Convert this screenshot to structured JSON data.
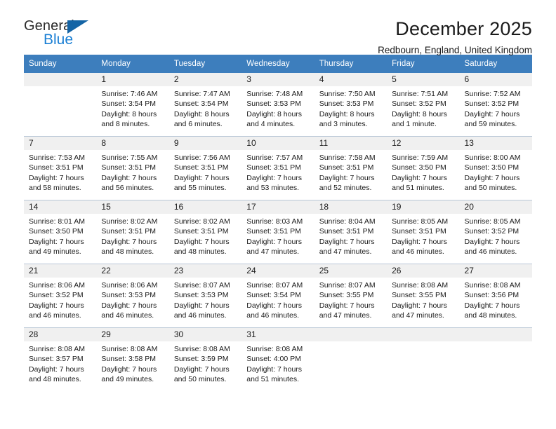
{
  "logo": {
    "text_primary": "General",
    "text_secondary": "Blue",
    "triangle_color": "#1464a5",
    "secondary_color": "#1a7fd4"
  },
  "header": {
    "title": "December 2025",
    "subtitle": "Redbourn, England, United Kingdom"
  },
  "theme": {
    "header_bar_color": "#3d7ebd",
    "daynum_bg": "#f0f0f0",
    "grid_line": "#b9c7d6"
  },
  "calendar": {
    "weekday_headers": [
      "Sunday",
      "Monday",
      "Tuesday",
      "Wednesday",
      "Thursday",
      "Friday",
      "Saturday"
    ],
    "weeks": [
      [
        {
          "day": "",
          "empty": true,
          "sunrise": "",
          "sunset": "",
          "daylight_1": "",
          "daylight_2": ""
        },
        {
          "day": "1",
          "sunrise": "Sunrise: 7:46 AM",
          "sunset": "Sunset: 3:54 PM",
          "daylight_1": "Daylight: 8 hours",
          "daylight_2": "and 8 minutes."
        },
        {
          "day": "2",
          "sunrise": "Sunrise: 7:47 AM",
          "sunset": "Sunset: 3:54 PM",
          "daylight_1": "Daylight: 8 hours",
          "daylight_2": "and 6 minutes."
        },
        {
          "day": "3",
          "sunrise": "Sunrise: 7:48 AM",
          "sunset": "Sunset: 3:53 PM",
          "daylight_1": "Daylight: 8 hours",
          "daylight_2": "and 4 minutes."
        },
        {
          "day": "4",
          "sunrise": "Sunrise: 7:50 AM",
          "sunset": "Sunset: 3:53 PM",
          "daylight_1": "Daylight: 8 hours",
          "daylight_2": "and 3 minutes."
        },
        {
          "day": "5",
          "sunrise": "Sunrise: 7:51 AM",
          "sunset": "Sunset: 3:52 PM",
          "daylight_1": "Daylight: 8 hours",
          "daylight_2": "and 1 minute."
        },
        {
          "day": "6",
          "sunrise": "Sunrise: 7:52 AM",
          "sunset": "Sunset: 3:52 PM",
          "daylight_1": "Daylight: 7 hours",
          "daylight_2": "and 59 minutes."
        }
      ],
      [
        {
          "day": "7",
          "sunrise": "Sunrise: 7:53 AM",
          "sunset": "Sunset: 3:51 PM",
          "daylight_1": "Daylight: 7 hours",
          "daylight_2": "and 58 minutes."
        },
        {
          "day": "8",
          "sunrise": "Sunrise: 7:55 AM",
          "sunset": "Sunset: 3:51 PM",
          "daylight_1": "Daylight: 7 hours",
          "daylight_2": "and 56 minutes."
        },
        {
          "day": "9",
          "sunrise": "Sunrise: 7:56 AM",
          "sunset": "Sunset: 3:51 PM",
          "daylight_1": "Daylight: 7 hours",
          "daylight_2": "and 55 minutes."
        },
        {
          "day": "10",
          "sunrise": "Sunrise: 7:57 AM",
          "sunset": "Sunset: 3:51 PM",
          "daylight_1": "Daylight: 7 hours",
          "daylight_2": "and 53 minutes."
        },
        {
          "day": "11",
          "sunrise": "Sunrise: 7:58 AM",
          "sunset": "Sunset: 3:51 PM",
          "daylight_1": "Daylight: 7 hours",
          "daylight_2": "and 52 minutes."
        },
        {
          "day": "12",
          "sunrise": "Sunrise: 7:59 AM",
          "sunset": "Sunset: 3:50 PM",
          "daylight_1": "Daylight: 7 hours",
          "daylight_2": "and 51 minutes."
        },
        {
          "day": "13",
          "sunrise": "Sunrise: 8:00 AM",
          "sunset": "Sunset: 3:50 PM",
          "daylight_1": "Daylight: 7 hours",
          "daylight_2": "and 50 minutes."
        }
      ],
      [
        {
          "day": "14",
          "sunrise": "Sunrise: 8:01 AM",
          "sunset": "Sunset: 3:50 PM",
          "daylight_1": "Daylight: 7 hours",
          "daylight_2": "and 49 minutes."
        },
        {
          "day": "15",
          "sunrise": "Sunrise: 8:02 AM",
          "sunset": "Sunset: 3:51 PM",
          "daylight_1": "Daylight: 7 hours",
          "daylight_2": "and 48 minutes."
        },
        {
          "day": "16",
          "sunrise": "Sunrise: 8:02 AM",
          "sunset": "Sunset: 3:51 PM",
          "daylight_1": "Daylight: 7 hours",
          "daylight_2": "and 48 minutes."
        },
        {
          "day": "17",
          "sunrise": "Sunrise: 8:03 AM",
          "sunset": "Sunset: 3:51 PM",
          "daylight_1": "Daylight: 7 hours",
          "daylight_2": "and 47 minutes."
        },
        {
          "day": "18",
          "sunrise": "Sunrise: 8:04 AM",
          "sunset": "Sunset: 3:51 PM",
          "daylight_1": "Daylight: 7 hours",
          "daylight_2": "and 47 minutes."
        },
        {
          "day": "19",
          "sunrise": "Sunrise: 8:05 AM",
          "sunset": "Sunset: 3:51 PM",
          "daylight_1": "Daylight: 7 hours",
          "daylight_2": "and 46 minutes."
        },
        {
          "day": "20",
          "sunrise": "Sunrise: 8:05 AM",
          "sunset": "Sunset: 3:52 PM",
          "daylight_1": "Daylight: 7 hours",
          "daylight_2": "and 46 minutes."
        }
      ],
      [
        {
          "day": "21",
          "sunrise": "Sunrise: 8:06 AM",
          "sunset": "Sunset: 3:52 PM",
          "daylight_1": "Daylight: 7 hours",
          "daylight_2": "and 46 minutes."
        },
        {
          "day": "22",
          "sunrise": "Sunrise: 8:06 AM",
          "sunset": "Sunset: 3:53 PM",
          "daylight_1": "Daylight: 7 hours",
          "daylight_2": "and 46 minutes."
        },
        {
          "day": "23",
          "sunrise": "Sunrise: 8:07 AM",
          "sunset": "Sunset: 3:53 PM",
          "daylight_1": "Daylight: 7 hours",
          "daylight_2": "and 46 minutes."
        },
        {
          "day": "24",
          "sunrise": "Sunrise: 8:07 AM",
          "sunset": "Sunset: 3:54 PM",
          "daylight_1": "Daylight: 7 hours",
          "daylight_2": "and 46 minutes."
        },
        {
          "day": "25",
          "sunrise": "Sunrise: 8:07 AM",
          "sunset": "Sunset: 3:55 PM",
          "daylight_1": "Daylight: 7 hours",
          "daylight_2": "and 47 minutes."
        },
        {
          "day": "26",
          "sunrise": "Sunrise: 8:08 AM",
          "sunset": "Sunset: 3:55 PM",
          "daylight_1": "Daylight: 7 hours",
          "daylight_2": "and 47 minutes."
        },
        {
          "day": "27",
          "sunrise": "Sunrise: 8:08 AM",
          "sunset": "Sunset: 3:56 PM",
          "daylight_1": "Daylight: 7 hours",
          "daylight_2": "and 48 minutes."
        }
      ],
      [
        {
          "day": "28",
          "sunrise": "Sunrise: 8:08 AM",
          "sunset": "Sunset: 3:57 PM",
          "daylight_1": "Daylight: 7 hours",
          "daylight_2": "and 48 minutes."
        },
        {
          "day": "29",
          "sunrise": "Sunrise: 8:08 AM",
          "sunset": "Sunset: 3:58 PM",
          "daylight_1": "Daylight: 7 hours",
          "daylight_2": "and 49 minutes."
        },
        {
          "day": "30",
          "sunrise": "Sunrise: 8:08 AM",
          "sunset": "Sunset: 3:59 PM",
          "daylight_1": "Daylight: 7 hours",
          "daylight_2": "and 50 minutes."
        },
        {
          "day": "31",
          "sunrise": "Sunrise: 8:08 AM",
          "sunset": "Sunset: 4:00 PM",
          "daylight_1": "Daylight: 7 hours",
          "daylight_2": "and 51 minutes."
        },
        {
          "day": "",
          "empty": true,
          "sunrise": "",
          "sunset": "",
          "daylight_1": "",
          "daylight_2": ""
        },
        {
          "day": "",
          "empty": true,
          "sunrise": "",
          "sunset": "",
          "daylight_1": "",
          "daylight_2": ""
        },
        {
          "day": "",
          "empty": true,
          "sunrise": "",
          "sunset": "",
          "daylight_1": "",
          "daylight_2": ""
        }
      ]
    ]
  }
}
